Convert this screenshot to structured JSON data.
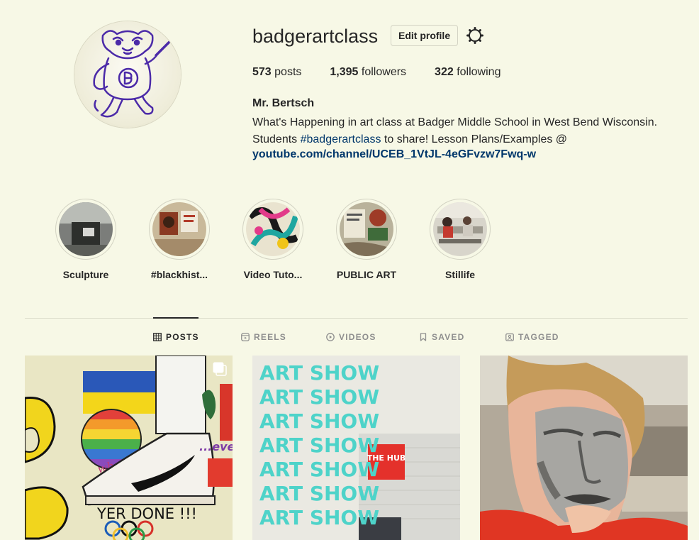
{
  "profile": {
    "username": "badgerartclass",
    "edit_label": "Edit profile",
    "stats": {
      "posts_count": "573",
      "posts_label": "posts",
      "followers_count": "1,395",
      "followers_label": "followers",
      "following_count": "322",
      "following_label": "following"
    },
    "full_name": "Mr. Bertsch",
    "bio_line1": "What's Happening in art class at Badger Middle School in West Bend Wisconsin.",
    "bio_line2_prefix": "Students ",
    "bio_hashtag": "#badgerartclass",
    "bio_line2_suffix": " to share! Lesson Plans/Examples @",
    "link": "youtube.com/channel/UCEB_1VtJL-4eGFvzw7Fwq-w"
  },
  "highlights": [
    {
      "label": "Sculpture"
    },
    {
      "label": "#blackhist..."
    },
    {
      "label": "Video Tuto..."
    },
    {
      "label": "PUBLIC ART"
    },
    {
      "label": "Stillife"
    }
  ],
  "tabs": [
    {
      "label": "POSTS",
      "icon": "grid-icon"
    },
    {
      "label": "REELS",
      "icon": "reels-icon"
    },
    {
      "label": "VIDEOS",
      "icon": "play-icon"
    },
    {
      "label": "SAVED",
      "icon": "bookmark-icon"
    },
    {
      "label": "TAGGED",
      "icon": "tagged-icon"
    }
  ],
  "posts": {
    "post1": {
      "banner_text": "YER DONE !!!",
      "side_text": "...eve",
      "what_text": "what?"
    },
    "post2": {
      "lines": [
        "ART SHOW",
        "ART SHOW",
        "ART SHOW",
        "ART SHOW",
        "ART SHOW",
        "ART SHOW",
        "ART SHOW"
      ],
      "sign_text": "THE HUB"
    }
  },
  "colors": {
    "background": "#f7f8e6",
    "link": "#00376b",
    "text": "#262626",
    "muted": "#8e8e8e"
  }
}
